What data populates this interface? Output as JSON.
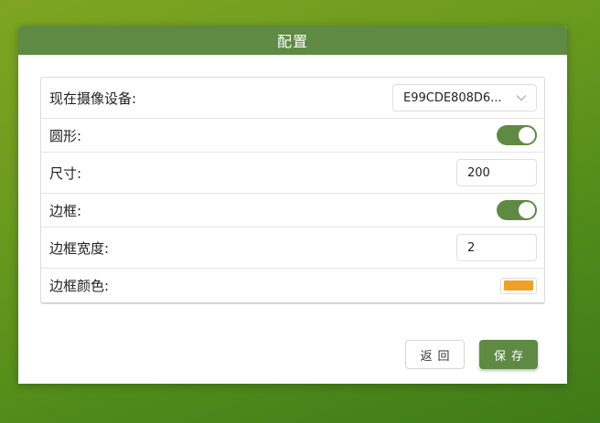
{
  "dialog": {
    "title": "配置"
  },
  "form": {
    "camera": {
      "label": "现在摄像设备:",
      "value": "E99CDE808D6..."
    },
    "circle": {
      "label": "圆形:",
      "enabled": true
    },
    "size": {
      "label": "尺寸:",
      "value": "200"
    },
    "border": {
      "label": "边框:",
      "enabled": true
    },
    "border_width": {
      "label": "边框宽度:",
      "value": "2"
    },
    "border_color": {
      "label": "边框颜色:",
      "color": "#f0a028"
    }
  },
  "buttons": {
    "back_label": "返回",
    "save_label": "保存"
  },
  "theme": {
    "accent": "#5f8a43"
  }
}
